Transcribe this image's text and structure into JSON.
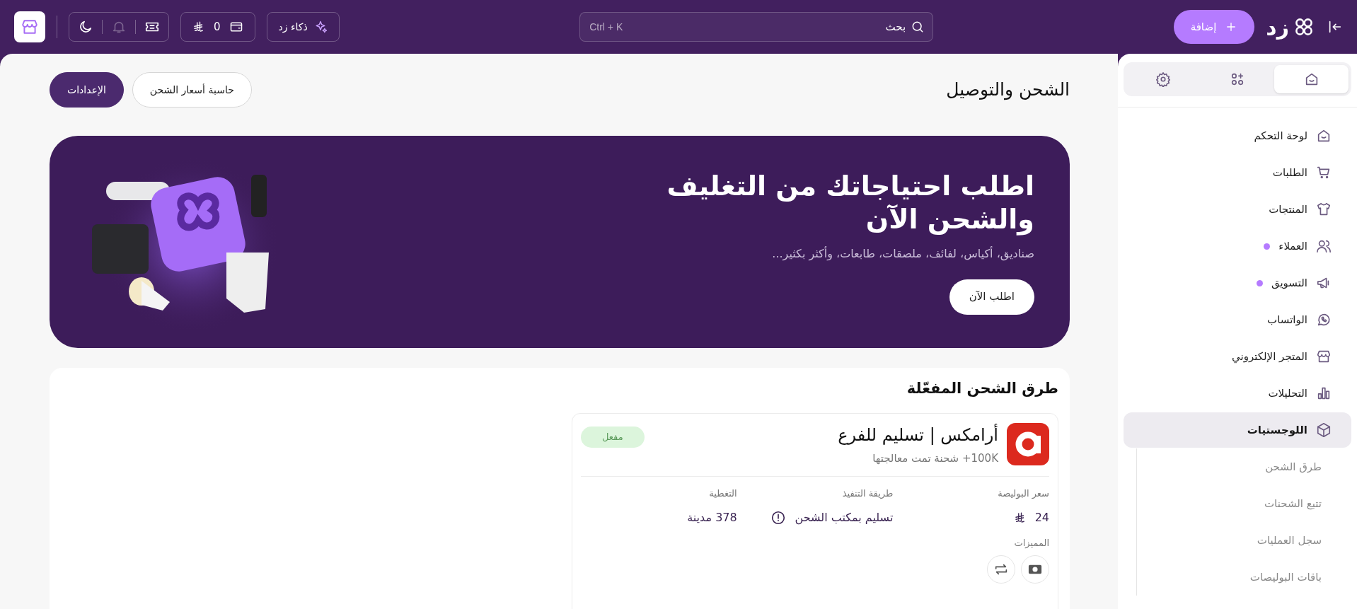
{
  "topbar": {
    "logo_text": "زد",
    "add_button": "إضافة",
    "search": {
      "placeholder": "بحث",
      "shortcut": "Ctrl + K"
    },
    "ai_button": "ذكاء زد",
    "wallet_balance": "0",
    "notifications_disabled": true
  },
  "sidebar": {
    "tabs": [
      {
        "selected": true
      },
      {
        "selected": false
      },
      {
        "selected": false
      }
    ],
    "items": [
      {
        "label": "لوحة التحكم",
        "dot": false,
        "selected": false
      },
      {
        "label": "الطلبات",
        "dot": false,
        "selected": false
      },
      {
        "label": "المنتجات",
        "dot": false,
        "selected": false
      },
      {
        "label": "العملاء",
        "dot": true,
        "selected": false
      },
      {
        "label": "التسويق",
        "dot": true,
        "selected": false
      },
      {
        "label": "الواتساب",
        "dot": false,
        "selected": false
      },
      {
        "label": "المتجر الإلكتروني",
        "dot": false,
        "selected": false
      },
      {
        "label": "التحليلات",
        "dot": false,
        "selected": false
      },
      {
        "label": "اللوجستيات",
        "dot": false,
        "selected": true,
        "children": [
          {
            "label": "طرق الشحن"
          },
          {
            "label": "تتبع الشحنات"
          },
          {
            "label": "سجل العمليات"
          },
          {
            "label": "باقات البوليصات"
          }
        ]
      }
    ]
  },
  "page": {
    "title": "الشحن والتوصيل",
    "buttons": [
      {
        "label": "حاسبة أسعار الشحن",
        "kind": "outline"
      },
      {
        "label": "الإعدادات",
        "kind": "primary"
      }
    ]
  },
  "banner": {
    "title": "اطلب احتياجاتك من التغليف والشحن الآن",
    "subtitle": "صناديق، أكياس، لفائف، ملصقات، طابعات، وأكثر بكثير...",
    "button": "اطلب الآن"
  },
  "shipping_methods": {
    "title": "طرق الشحن المفعّلة",
    "cards": [
      {
        "name": "أرامكس | تسليم للفرع",
        "processed": "100K+ شحنة تمت معالجتها",
        "status": {
          "label": "مفعل",
          "kind": "active"
        },
        "fields": [
          {
            "label": "سعر البوليصة",
            "value": "24",
            "kind": "price"
          },
          {
            "label": "طريقة التنفيذ",
            "value": "تسليم بمكتب الشحن",
            "kind": "info"
          },
          {
            "label": "التغطية",
            "value": "378 مدينة",
            "kind": "text"
          }
        ],
        "features_label": "المميزات"
      }
    ]
  }
}
